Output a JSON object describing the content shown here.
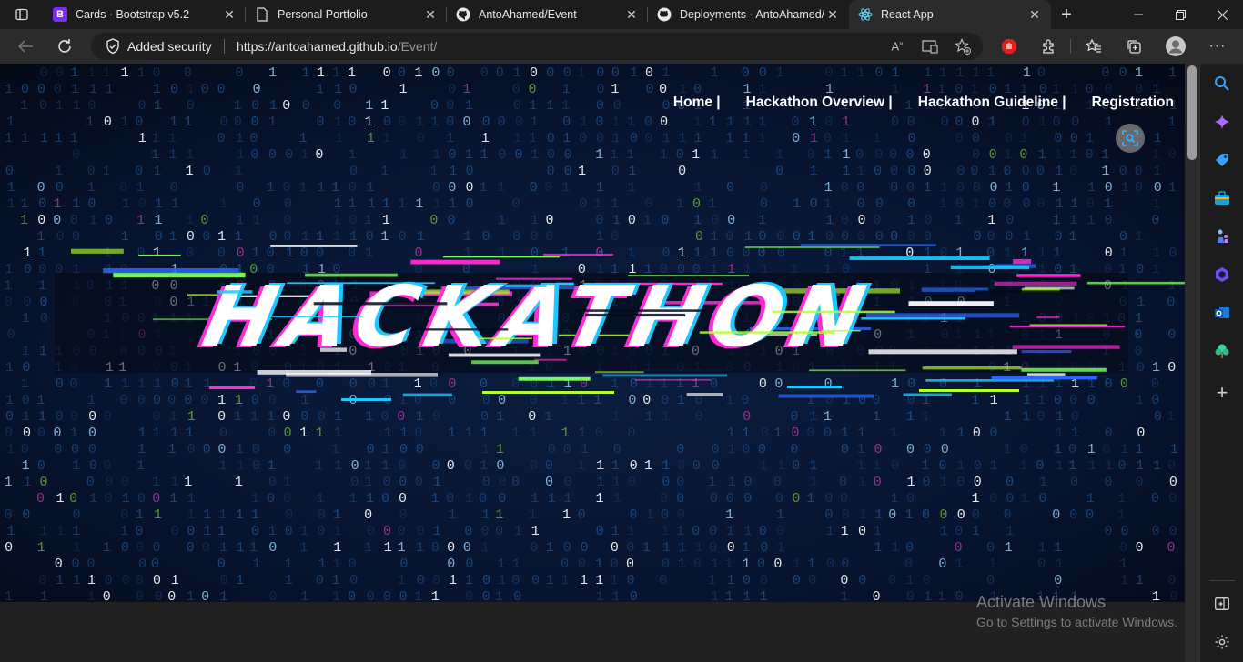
{
  "browser": {
    "tabs": [
      {
        "title": "Cards · Bootstrap v5.2",
        "icon": "bootstrap-icon",
        "icon_letter": "B"
      },
      {
        "title": "Personal Portfolio",
        "icon": "page-icon"
      },
      {
        "title": "AntoAhamed/Event",
        "icon": "github-icon"
      },
      {
        "title": "Deployments · AntoAhamed/",
        "icon": "github-icon"
      },
      {
        "title": "React App",
        "icon": "react-icon",
        "active": true
      }
    ],
    "security_label": "Added security",
    "url_host": "https://antoahamed.github.io",
    "url_path": "/Event/"
  },
  "page": {
    "nav": [
      "Home |",
      "Hackathon Overview |",
      "Hackathon Guideline |",
      "Registration"
    ],
    "hero_title": "HACKATHON"
  },
  "watermark": {
    "line1": "Activate Windows",
    "line2": "Go to Settings to activate Windows."
  },
  "colors": {
    "accent_cyan": "#1ec8ff",
    "accent_magenta": "#ff2bd6",
    "accent_green": "#b4ff2a",
    "page_bg": "#050a1a"
  }
}
